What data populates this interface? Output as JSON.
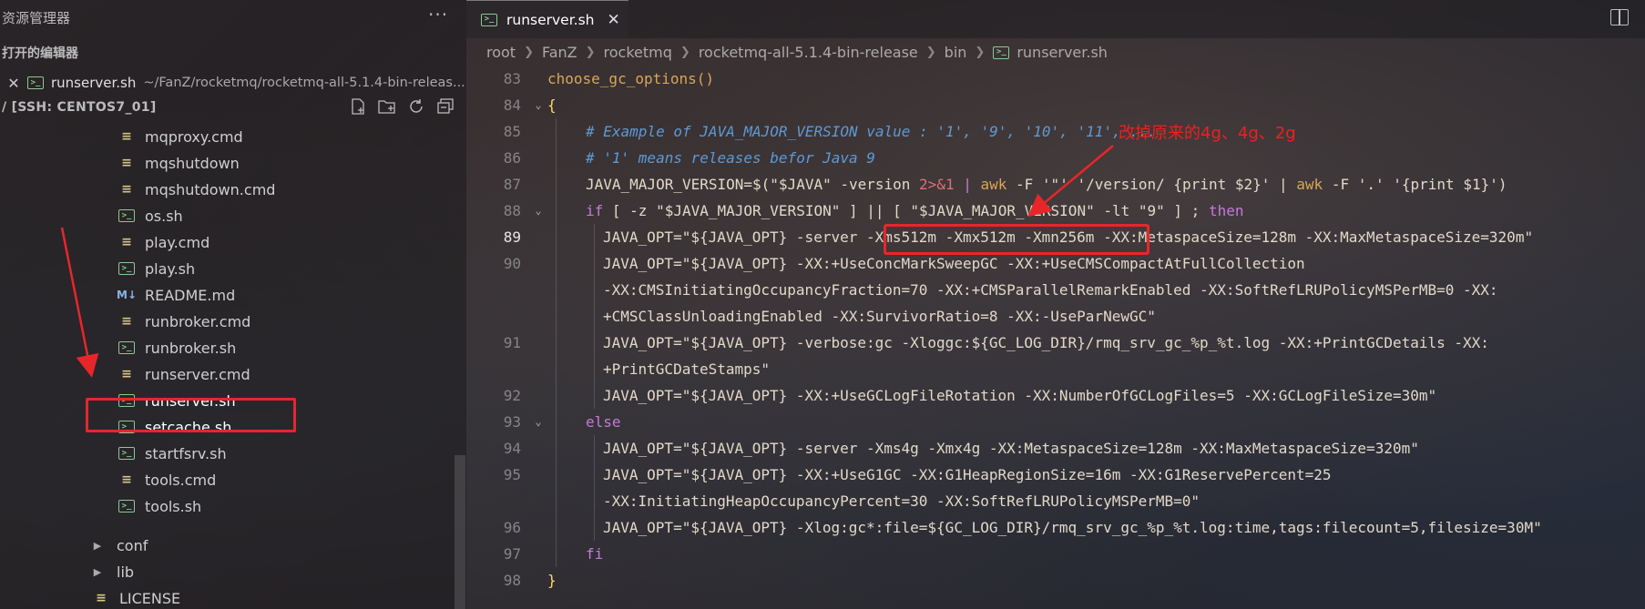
{
  "sidebar": {
    "title": "资源管理器",
    "more": "···",
    "open_editors_label": "打开的编辑器",
    "open_editor": {
      "close": "✕",
      "name": "runserver.sh",
      "path": "~/FanZ/rocketmq/rocketmq-all-5.1.4-bin-releas..."
    },
    "ssh_label": "/ [SSH: CENTOS7_01]",
    "files": [
      {
        "name": "mqproxy.cmd",
        "icon": "lines-icon"
      },
      {
        "name": "mqshutdown",
        "icon": "lines-icon"
      },
      {
        "name": "mqshutdown.cmd",
        "icon": "lines-icon"
      },
      {
        "name": "os.sh",
        "icon": "shell-icon"
      },
      {
        "name": "play.cmd",
        "icon": "lines-icon"
      },
      {
        "name": "play.sh",
        "icon": "shell-icon"
      },
      {
        "name": "README.md",
        "icon": "markdown-icon"
      },
      {
        "name": "runbroker.cmd",
        "icon": "lines-icon"
      },
      {
        "name": "runbroker.sh",
        "icon": "shell-icon"
      },
      {
        "name": "runserver.cmd",
        "icon": "lines-icon"
      },
      {
        "name": "runserver.sh",
        "icon": "shell-icon"
      },
      {
        "name": "setcache.sh",
        "icon": "shell-icon"
      },
      {
        "name": "startfsrv.sh",
        "icon": "shell-icon"
      },
      {
        "name": "tools.cmd",
        "icon": "lines-icon"
      },
      {
        "name": "tools.sh",
        "icon": "shell-icon"
      }
    ],
    "folders": [
      {
        "name": "conf"
      },
      {
        "name": "lib"
      }
    ],
    "license": "LICENSE"
  },
  "tab": {
    "name": "runserver.sh",
    "close": "✕"
  },
  "breadcrumb": [
    "root",
    "FanZ",
    "rocketmq",
    "rocketmq-all-5.1.4-bin-release",
    "bin",
    "runserver.sh"
  ],
  "annotation": "改掉原来的4g、4g、2g",
  "code": {
    "line_numbers": [
      "83",
      "84",
      "85",
      "86",
      "87",
      "88",
      "89",
      "90",
      "",
      "",
      "91",
      "",
      "92",
      "93",
      "94",
      "95",
      "",
      "96",
      "97",
      "98"
    ],
    "l83": "choose_gc_options()",
    "l84": "{",
    "l85": "# Example of JAVA_MAJOR_VERSION value : '1', '9', '10', '11', ...",
    "l86": "# '1' means releases befor Java 9",
    "l87a": "JAVA_MAJOR_VERSION=$(\"$JAVA\" -version ",
    "l87b": "2>&1",
    "l87c": " | ",
    "l87d": "awk",
    "l87e": " -F '\"' '/version/ {print $2}' | ",
    "l87f": "awk",
    "l87g": " -F '.' '{print $1}')",
    "l88a": "if",
    "l88b": " [ -z \"$JAVA_MAJOR_VERSION\" ] || [ \"$JAVA_MAJOR_VERSION\" -lt \"9\" ] ; ",
    "l88c": "then",
    "l89": "JAVA_OPT=\"${JAVA_OPT} -server -Xms512m -Xmx512m -Xmn256m -XX:MetaspaceSize=128m -XX:MaxMetaspaceSize=320m\"",
    "l90a": "JAVA_OPT=\"${JAVA_OPT} -XX:+UseConcMarkSweepGC -XX:+UseCMSCompactAtFullCollection",
    "l90b": "-XX:CMSInitiatingOccupancyFraction=70 -XX:+CMSParallelRemarkEnabled -XX:SoftRefLRUPolicyMSPerMB=0 -XX:",
    "l90c": "+CMSClassUnloadingEnabled -XX:SurvivorRatio=8 -XX:-UseParNewGC\"",
    "l91a": "JAVA_OPT=\"${JAVA_OPT} -verbose:gc -Xloggc:${GC_LOG_DIR}/rmq_srv_gc_%p_%t.log -XX:+PrintGCDetails -XX:",
    "l91b": "+PrintGCDateStamps\"",
    "l92": "JAVA_OPT=\"${JAVA_OPT} -XX:+UseGCLogFileRotation -XX:NumberOfGCLogFiles=5 -XX:GCLogFileSize=30m\"",
    "l93": "else",
    "l94": "JAVA_OPT=\"${JAVA_OPT} -server -Xms4g -Xmx4g -XX:MetaspaceSize=128m -XX:MaxMetaspaceSize=320m\"",
    "l95a": "JAVA_OPT=\"${JAVA_OPT} -XX:+UseG1GC -XX:G1HeapRegionSize=16m -XX:G1ReservePercent=25",
    "l95b": "-XX:InitiatingHeapOccupancyPercent=30 -XX:SoftRefLRUPolicyMSPerMB=0\"",
    "l96": "JAVA_OPT=\"${JAVA_OPT} -Xlog:gc*:file=${GC_LOG_DIR}/rmq_srv_gc_%p_%t.log:time,tags:filecount=5,filesize=30M\"",
    "l97": "fi",
    "l98": "}"
  },
  "colors": {
    "accent_red": "#e8262a",
    "shell_icon": "#8dc891",
    "comment": "#5c9ad6",
    "keyword": "#c678dd"
  }
}
